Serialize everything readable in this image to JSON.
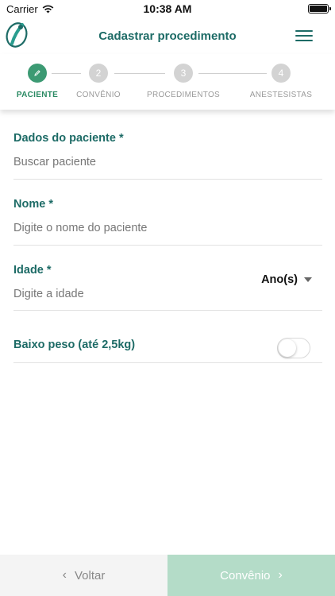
{
  "status_bar": {
    "carrier": "Carrier",
    "time": "10:38 AM"
  },
  "header": {
    "title": "Cadastrar procedimento"
  },
  "stepper": {
    "steps": [
      {
        "number": "",
        "label": "PACIENTE",
        "state": "active"
      },
      {
        "number": "2",
        "label": "CONVÊNIO",
        "state": "inactive"
      },
      {
        "number": "3",
        "label": "PROCEDIMENTOS",
        "state": "inactive"
      },
      {
        "number": "4",
        "label": "ANESTESISTAS",
        "state": "inactive"
      }
    ]
  },
  "form": {
    "patient": {
      "label": "Dados do paciente *",
      "placeholder": "Buscar paciente"
    },
    "name": {
      "label": "Nome *",
      "placeholder": "Digite o nome do paciente"
    },
    "age": {
      "label": "Idade *",
      "placeholder": "Digite a idade",
      "unit": "Ano(s)"
    },
    "low_weight": {
      "label": "Baixo peso (até 2,5kg)",
      "checked": false
    }
  },
  "footer": {
    "back_label": "Voltar",
    "next_label": "Convênio"
  },
  "colors": {
    "brand_teal": "#1d6b66",
    "active_green": "#3c9a73",
    "next_button_bg": "#b4dcc8"
  }
}
